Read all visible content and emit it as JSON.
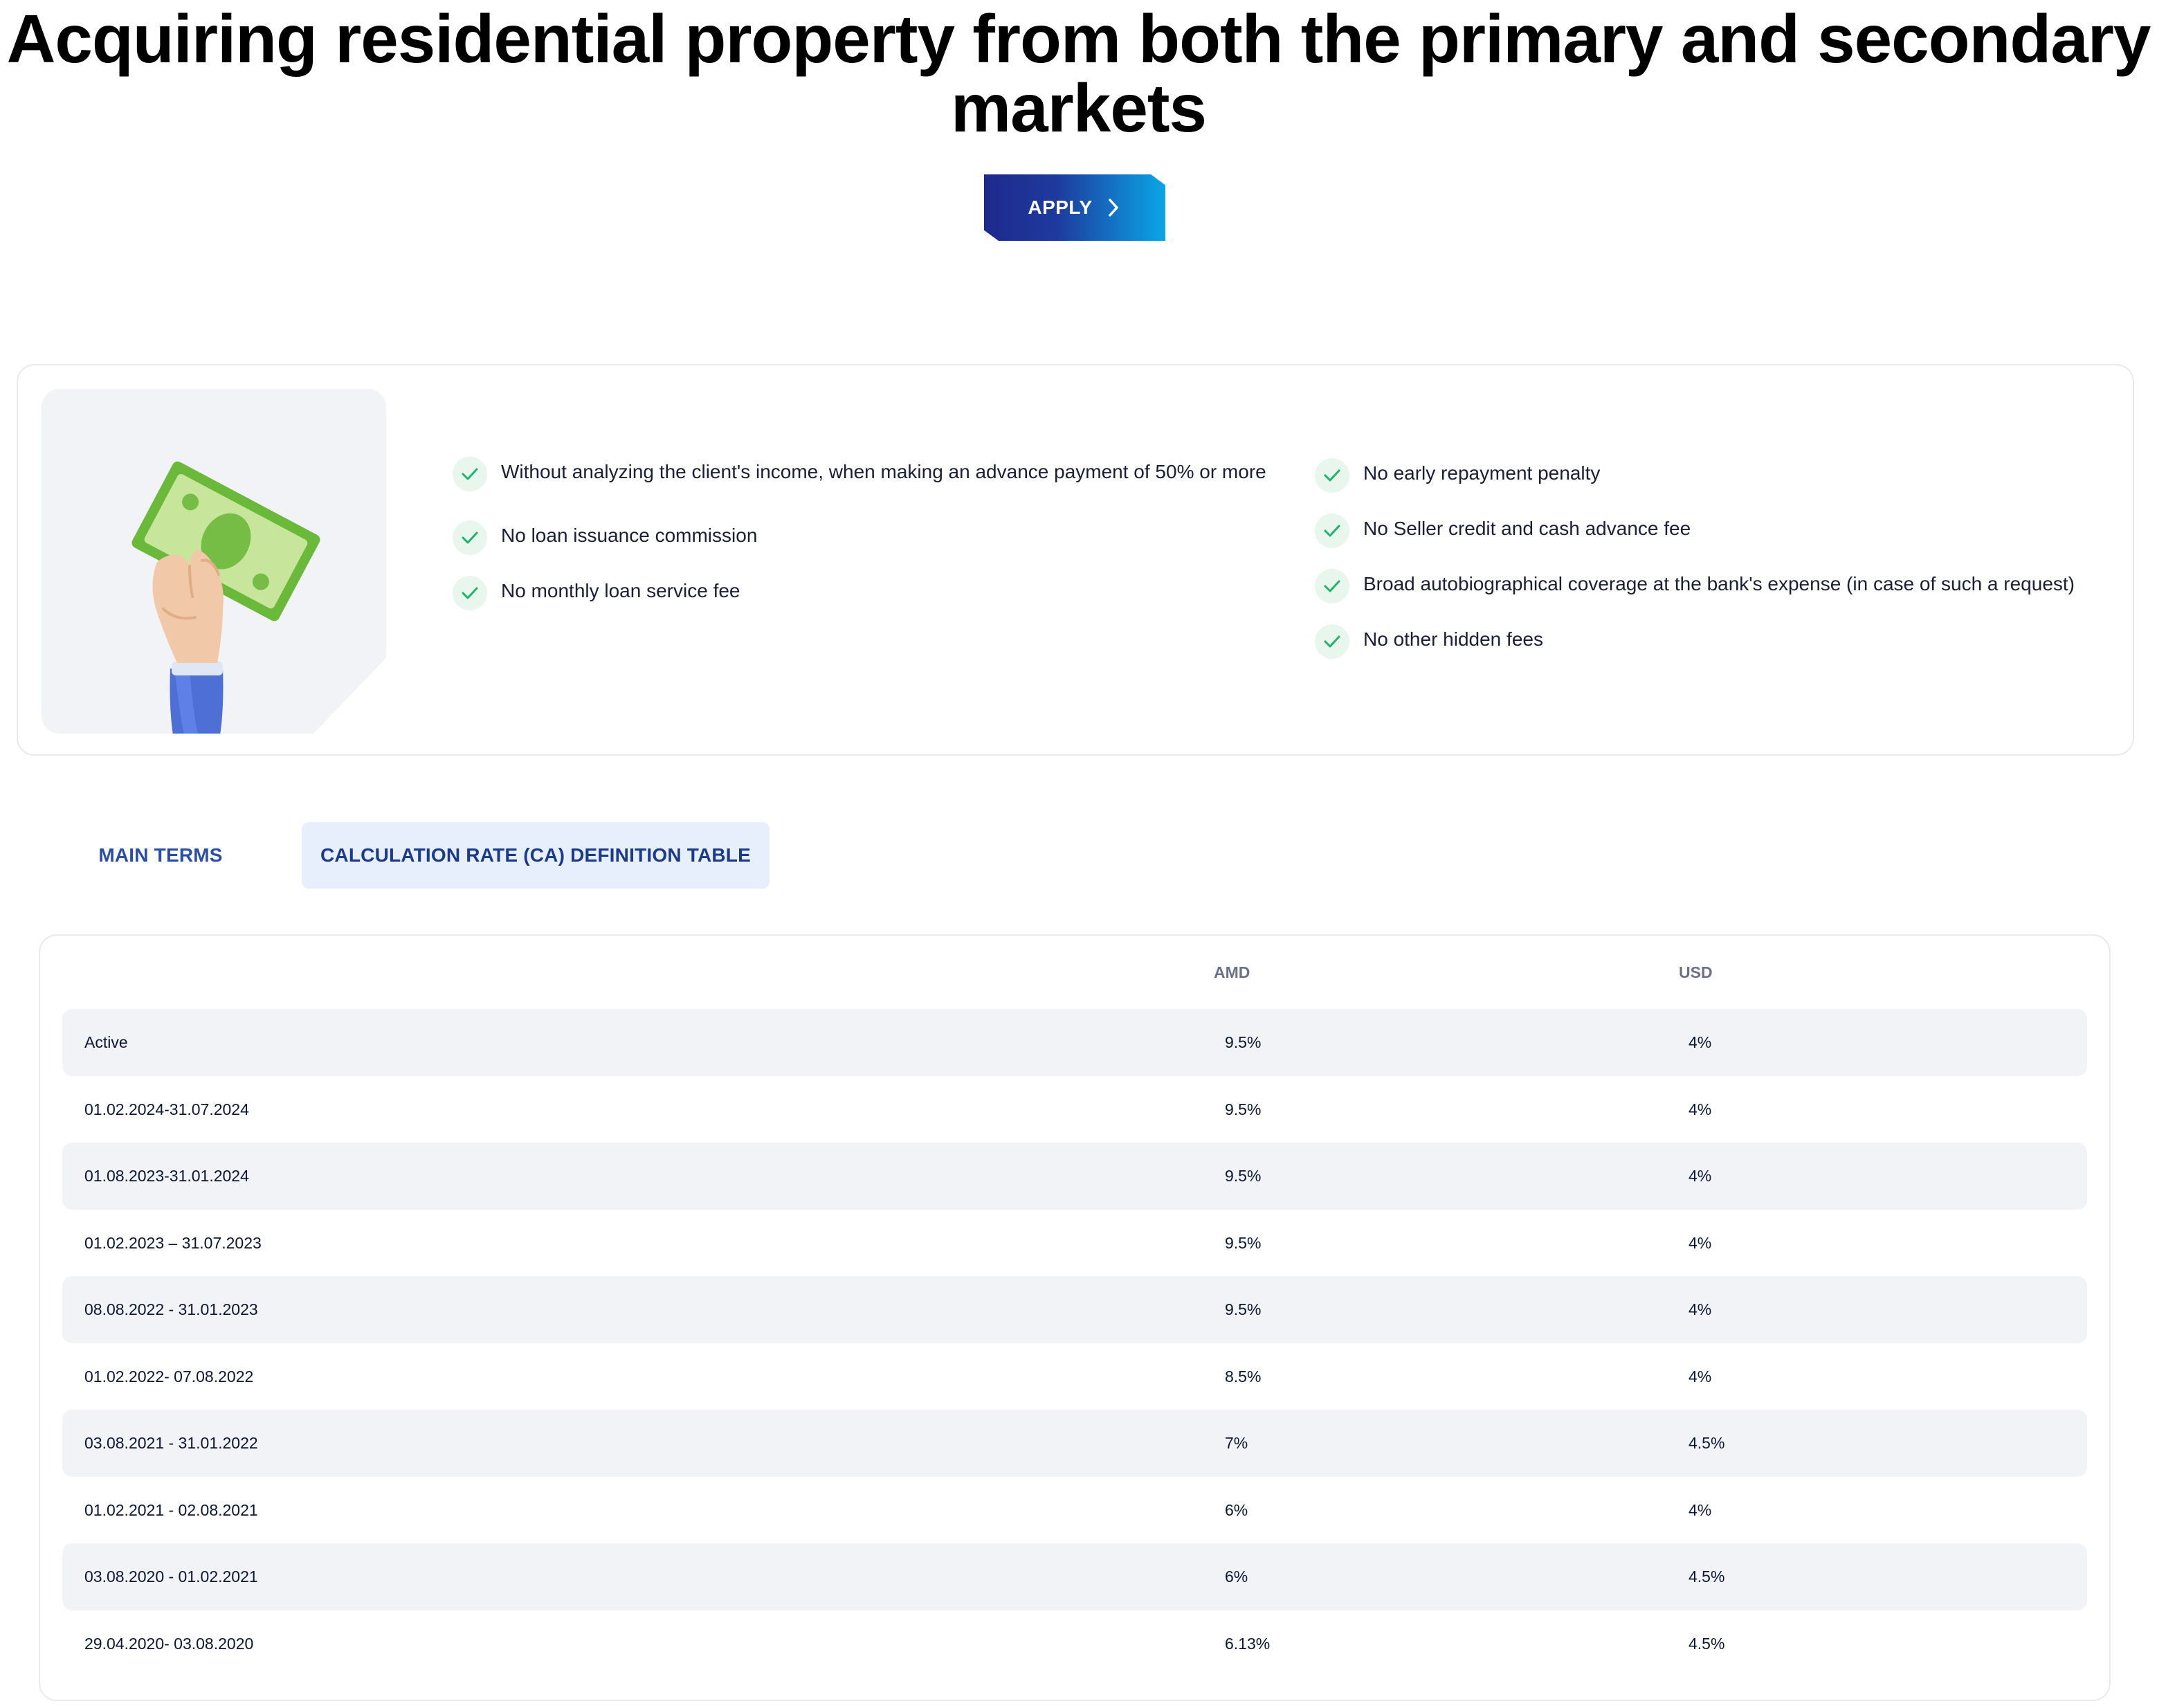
{
  "hero": {
    "title": "Acquiring residential property from both the primary and secondary markets",
    "apply_label": "APPLY"
  },
  "features": {
    "left": [
      "Without analyzing the client's income, when making an advance payment of 50% or more",
      "No loan issuance commission",
      "No monthly loan service fee"
    ],
    "right": [
      "No early repayment penalty",
      "No Seller credit and cash advance fee",
      "Broad autobiographical coverage at the bank's expense (in case of such a request)",
      "No other hidden fees"
    ]
  },
  "tabs": [
    {
      "label": "MAIN TERMS",
      "active": false
    },
    {
      "label": "CALCULATION RATE (CA) DEFINITION TABLE",
      "active": true
    }
  ],
  "table": {
    "headers": [
      "",
      "AMD",
      "USD"
    ],
    "rows": [
      [
        "Active",
        "9.5%",
        "4%"
      ],
      [
        "01.02.2024-31.07.2024",
        "9.5%",
        "4%"
      ],
      [
        "01.08.2023-31.01.2024",
        "9.5%",
        "4%"
      ],
      [
        "01.02.2023 – 31.07.2023",
        "9.5%",
        "4%"
      ],
      [
        "08.08.2022 - 31.01.2023",
        "9.5%",
        "4%"
      ],
      [
        "01.02.2022- 07.08.2022",
        "8.5%",
        "4%"
      ],
      [
        "03.08.2021 - 31.01.2022",
        "7%",
        "4.5%"
      ],
      [
        "01.02.2021 - 02.08.2021",
        "6%",
        "4%"
      ],
      [
        "03.08.2020 - 01.02.2021",
        "6%",
        "4.5%"
      ],
      [
        "29.04.2020- 03.08.2020",
        "6.13%",
        "4.5%"
      ]
    ]
  },
  "colors": {
    "accent_dark": "#1d2a8c",
    "accent_light": "#0aa6e6",
    "tab_active_bg": "#e6effb",
    "check_green": "#1fb36b",
    "row_stripe": "#f2f3f7"
  },
  "icons": {
    "apply_button": "chevron-right-icon",
    "feature_bullet": "check-icon",
    "illustration": "hand-holding-banknote-illustration"
  }
}
